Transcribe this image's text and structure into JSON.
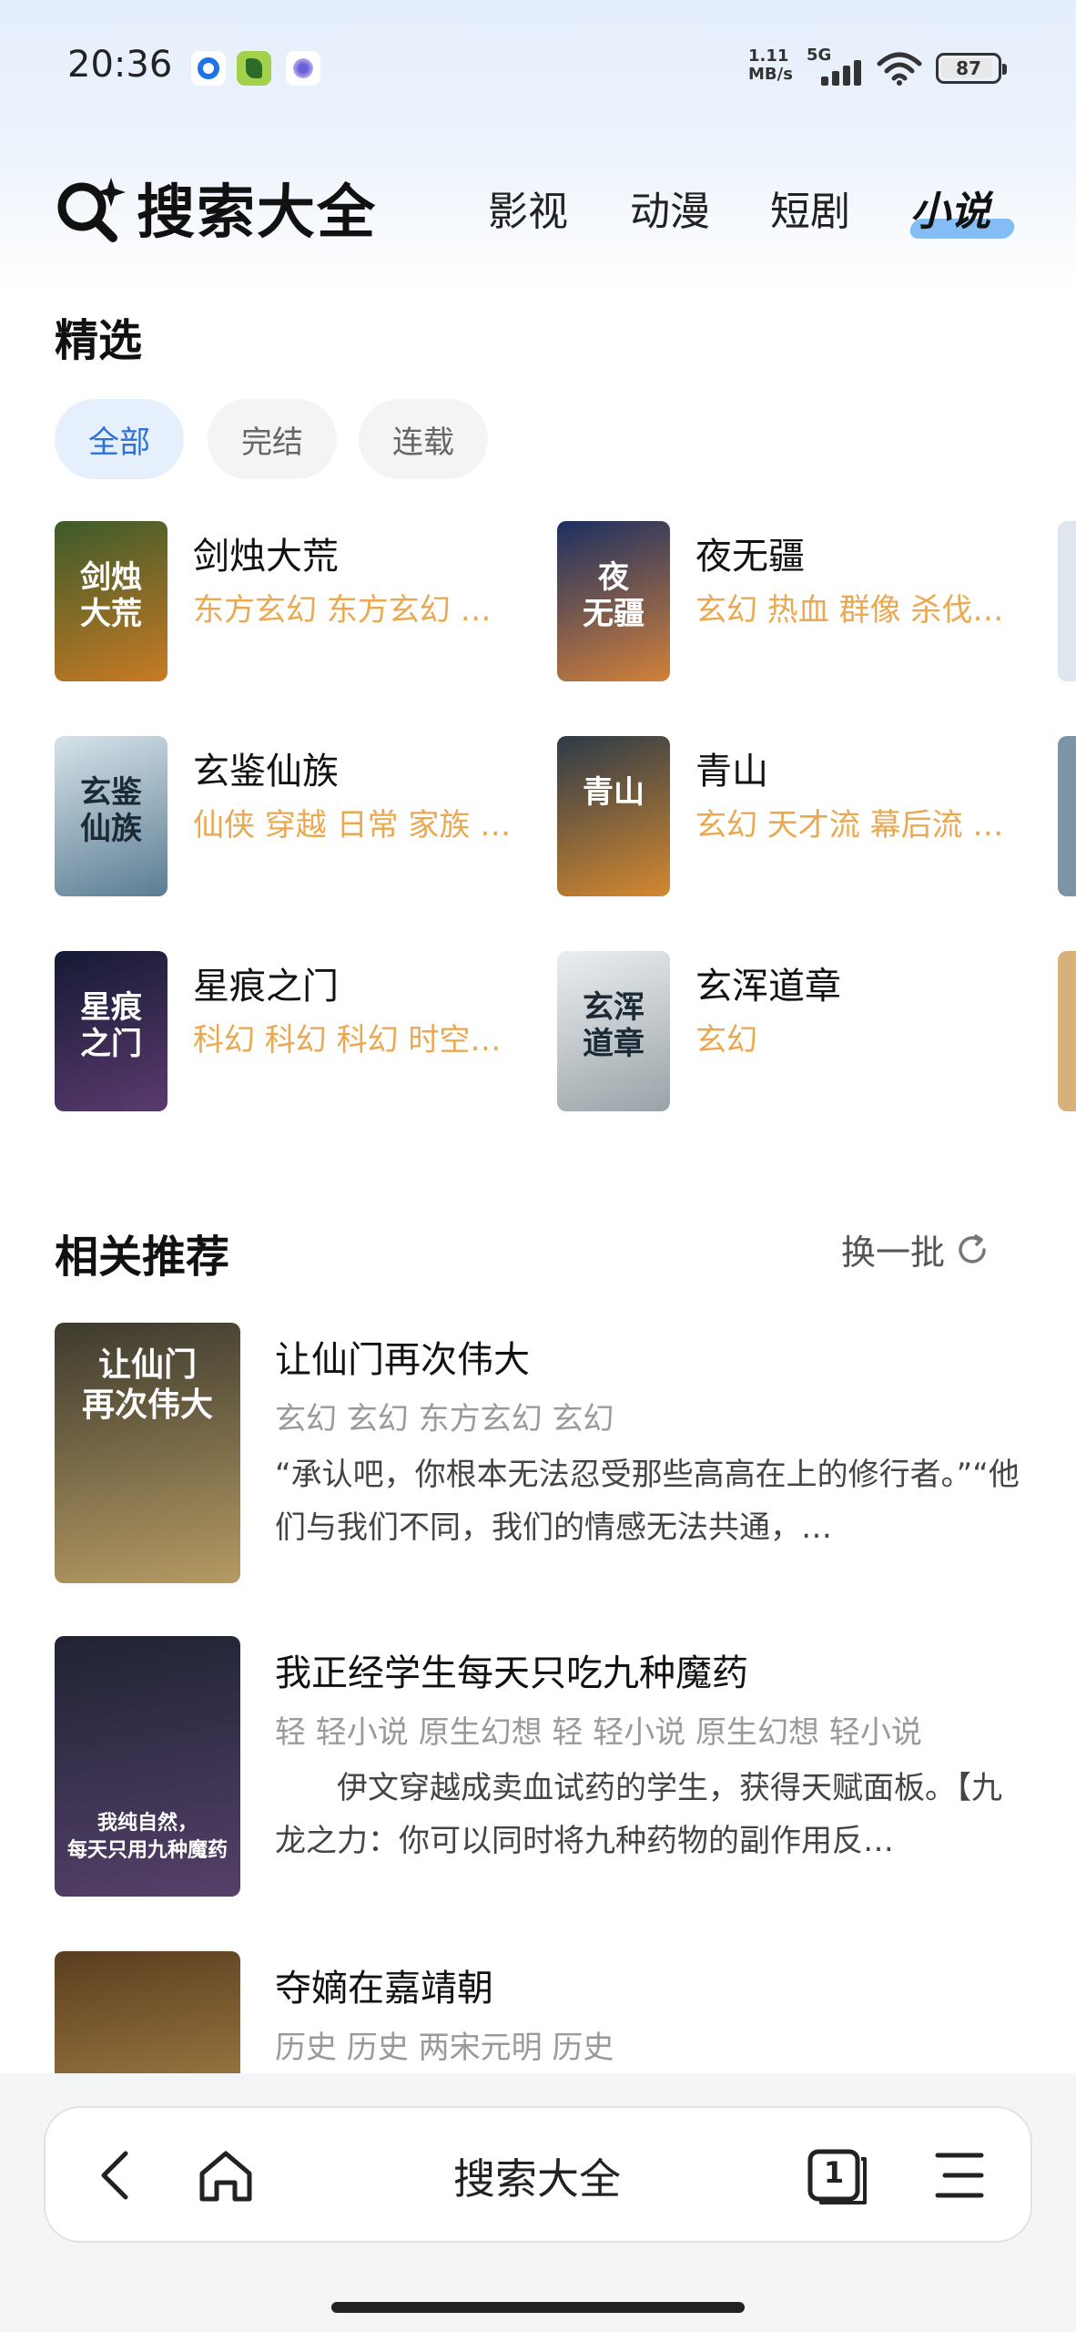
{
  "status_bar": {
    "time": "20:36",
    "net_speed_value": "1.11",
    "net_speed_unit": "MB/s",
    "network": "5G",
    "battery": "87"
  },
  "header": {
    "title": "搜索大全",
    "tabs": [
      {
        "label": "影视",
        "active": false
      },
      {
        "label": "动漫",
        "active": false
      },
      {
        "label": "短剧",
        "active": false
      },
      {
        "label": "小说",
        "active": true
      }
    ]
  },
  "featured": {
    "title": "精选",
    "filters": [
      {
        "label": "全部",
        "active": true
      },
      {
        "label": "完结",
        "active": false
      },
      {
        "label": "连载",
        "active": false
      }
    ],
    "books": [
      {
        "title": "剑烛大荒",
        "tags": "东方玄幻 东方玄幻 …",
        "cover_text": "剑烛\n大荒",
        "cover_colors": [
          "#3b5b2a",
          "#c97a24"
        ]
      },
      {
        "title": "夜无疆",
        "tags": "玄幻 热血 群像 杀伐…",
        "cover_text": "夜\n无疆",
        "cover_colors": [
          "#1c2f62",
          "#d1813a"
        ]
      },
      {
        "title": "玄鉴仙族",
        "tags": "仙侠 穿越 日常 家族 …",
        "cover_text": "玄鉴\n仙族",
        "cover_colors": [
          "#d7e3ea",
          "#5a7d93"
        ]
      },
      {
        "title": "青山",
        "tags": "玄幻 天才流 幕后流 …",
        "cover_text": "青山",
        "cover_colors": [
          "#2d3a48",
          "#d4892f"
        ]
      },
      {
        "title": "星痕之门",
        "tags": "科幻 科幻 科幻 时空…",
        "cover_text": "星痕\n之门",
        "cover_colors": [
          "#151a33",
          "#5b3a6f"
        ]
      },
      {
        "title": "玄浑道章",
        "tags": "玄幻",
        "cover_text": "玄浑\n道章",
        "cover_colors": [
          "#eceff1",
          "#9aa3a8"
        ]
      }
    ],
    "peek_colors": [
      "#dfe6ee",
      "#7d93a6",
      "#d8b07a"
    ]
  },
  "recommend": {
    "title": "相关推荐",
    "refresh_label": "换一批",
    "items": [
      {
        "title": "让仙门再次伟大",
        "tags": "玄幻 玄幻 东方玄幻 玄幻",
        "desc": "“承认吧，你根本无法忍受那些高高在上的修行者。”“他们与我们不同，我们的情感无法共通，…",
        "cover_text": "让仙门\n再次伟大",
        "cover_colors": [
          "#3d3a2e",
          "#b59a62"
        ]
      },
      {
        "title": "我正经学生每天只吃九种魔药",
        "tags": "轻 轻小说 原生幻想 轻 轻小说 原生幻想 轻小说",
        "desc": "　　伊文穿越成卖血试药的学生，获得天赋面板。【九龙之力：你可以同时将九种药物的副作用反…",
        "cover_text": "我纯自然，\n每天只用九种魔药",
        "cover_colors": [
          "#1f2433",
          "#55406a"
        ]
      },
      {
        "title": "夺嫡在嘉靖朝",
        "tags": "历史 历史 两宋元明 历史",
        "desc": "",
        "cover_text": "",
        "cover_colors": [
          "#5a3d1e",
          "#c8a25a"
        ]
      }
    ]
  },
  "bottom_bar": {
    "title": "搜索大全",
    "tab_count": "1"
  }
}
